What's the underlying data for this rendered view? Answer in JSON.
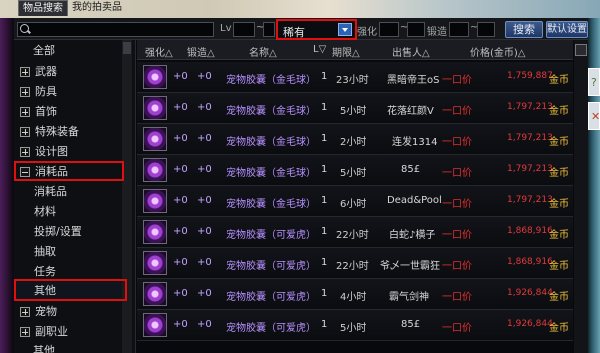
{
  "tabs": [
    {
      "label": "物品搜索",
      "active": true
    },
    {
      "label": "我的拍卖品",
      "active": false
    }
  ],
  "filter": {
    "search_value": "",
    "lv_label": "Lv",
    "tilde": "~",
    "rarity_value": "稀有",
    "enhance_label": "强化",
    "forge_label": "锻造",
    "search_button": "搜索",
    "default_button": "默认设置"
  },
  "sidebar": {
    "items": [
      {
        "label": "全部",
        "kind": "top"
      },
      {
        "label": "武器",
        "kind": "expand"
      },
      {
        "label": "防具",
        "kind": "expand"
      },
      {
        "label": "首饰",
        "kind": "expand"
      },
      {
        "label": "特殊装备",
        "kind": "expand"
      },
      {
        "label": "设计图",
        "kind": "expand"
      },
      {
        "label": "消耗品",
        "kind": "collapse"
      },
      {
        "label": "消耗品",
        "kind": "sub"
      },
      {
        "label": "材料",
        "kind": "sub"
      },
      {
        "label": "投掷/设置",
        "kind": "sub"
      },
      {
        "label": "抽取",
        "kind": "sub"
      },
      {
        "label": "任务",
        "kind": "sub"
      },
      {
        "label": "其他",
        "kind": "sub",
        "selected": true
      },
      {
        "label": "宠物",
        "kind": "expand"
      },
      {
        "label": "副职业",
        "kind": "expand"
      },
      {
        "label": "其他",
        "kind": "top"
      }
    ]
  },
  "table": {
    "headers": {
      "enhance": "强化△",
      "forge": "锻造△",
      "name": "名称△",
      "count": "L▽",
      "time": "期限△",
      "seller": "出售人△",
      "price": "价格(金币)△"
    },
    "rows": [
      {
        "enhance": "+0",
        "forge": "+0",
        "name": "宠物胶囊（金毛球）",
        "count": "1",
        "time": "23小时",
        "seller": "黑暗帝王oS",
        "bid": "一口价",
        "price": "1,759,887",
        "currency": "金币"
      },
      {
        "enhance": "+0",
        "forge": "+0",
        "name": "宠物胶囊（金毛球）",
        "count": "1",
        "time": "5小时",
        "seller": "花落红颜V",
        "bid": "一口价",
        "price": "1,797,213",
        "currency": "金币"
      },
      {
        "enhance": "+0",
        "forge": "+0",
        "name": "宠物胶囊（金毛球）",
        "count": "1",
        "time": "2小时",
        "seller": "连发1314",
        "bid": "一口价",
        "price": "1,797,213",
        "currency": "金币"
      },
      {
        "enhance": "+0",
        "forge": "+0",
        "name": "宠物胶囊（金毛球）",
        "count": "1",
        "time": "5小时",
        "seller": "85£",
        "bid": "一口价",
        "price": "1,797,213",
        "currency": "金币"
      },
      {
        "enhance": "+0",
        "forge": "+0",
        "name": "宠物胶囊（金毛球）",
        "count": "1",
        "time": "6小时",
        "seller": "Dead&Pool",
        "bid": "一口价",
        "price": "1,797,213",
        "currency": "金币"
      },
      {
        "enhance": "+0",
        "forge": "+0",
        "name": "宠物胶囊（可爱虎）",
        "count": "1",
        "time": "22小时",
        "seller": "白蛇♪横子",
        "bid": "一口价",
        "price": "1,868,916",
        "currency": "金币"
      },
      {
        "enhance": "+0",
        "forge": "+0",
        "name": "宠物胶囊（可爱虎）",
        "count": "1",
        "time": "22小时",
        "seller": "爷乄一世霸狂",
        "bid": "一口价",
        "price": "1,868,916",
        "currency": "金币"
      },
      {
        "enhance": "+0",
        "forge": "+0",
        "name": "宠物胶囊（可爱虎）",
        "count": "1",
        "time": "4小时",
        "seller": "霸气剑神",
        "bid": "一口价",
        "price": "1,926,844",
        "currency": "金币"
      },
      {
        "enhance": "+0",
        "forge": "+0",
        "name": "宠物胶囊（可爱虎）",
        "count": "1",
        "time": "5小时",
        "seller": "85£",
        "bid": "一口价",
        "price": "1,926,844",
        "currency": "金币"
      }
    ]
  }
}
